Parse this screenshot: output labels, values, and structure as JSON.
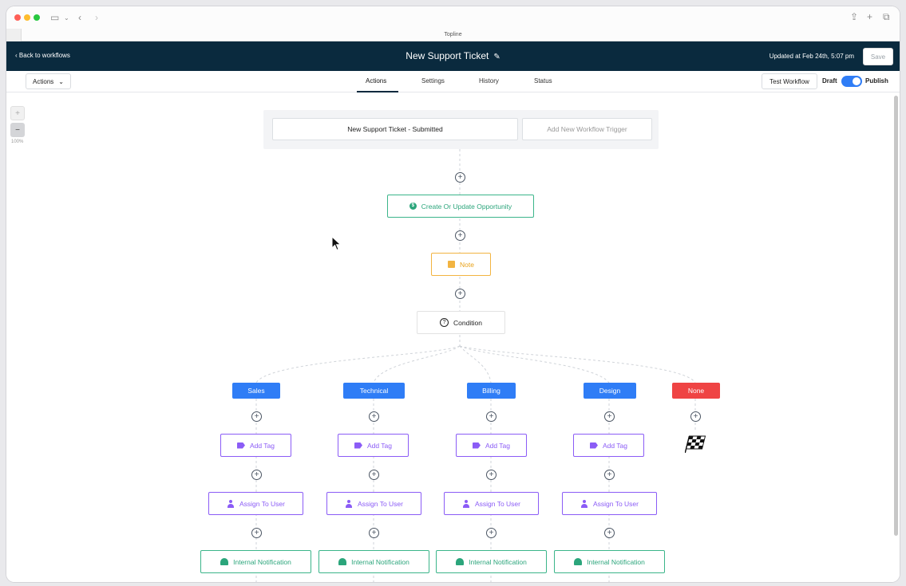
{
  "browser": {
    "tab_title": "Topline"
  },
  "header": {
    "back_label": "Back to workflows",
    "title": "New Support Ticket",
    "updated": "Updated at Feb 24th, 5:07 pm",
    "save_label": "Save"
  },
  "toolbar": {
    "actions_label": "Actions",
    "tabs": [
      "Actions",
      "Settings",
      "History",
      "Status"
    ],
    "active_tab": "Actions",
    "test_label": "Test Workflow",
    "draft_label": "Draft",
    "publish_label": "Publish",
    "published": true
  },
  "zoom": {
    "in_label": "+",
    "out_label": "−",
    "level": "100%"
  },
  "triggers": {
    "primary": "New Support Ticket - Submitted",
    "add_label": "Add New Workflow Trigger"
  },
  "steps": {
    "opportunity": "Create Or Update Opportunity",
    "note": "Note",
    "condition": "Condition"
  },
  "branches": [
    {
      "label": "Sales",
      "steps": [
        "Add Tag",
        "Assign To User",
        "Internal Notification"
      ]
    },
    {
      "label": "Technical",
      "steps": [
        "Add Tag",
        "Assign To User",
        "Internal Notification"
      ]
    },
    {
      "label": "Billing",
      "steps": [
        "Add Tag",
        "Assign To User",
        "Internal Notification"
      ]
    },
    {
      "label": "Design",
      "steps": [
        "Add Tag",
        "Assign To User",
        "Internal Notification"
      ]
    },
    {
      "label": "None",
      "steps": []
    }
  ],
  "colors": {
    "header_bg": "#0a2a3e",
    "branch_blue": "#2f7df6",
    "branch_red": "#ef4444",
    "green": "#2ba57b",
    "orange": "#e8a21a",
    "purple": "#8b5cf6"
  }
}
